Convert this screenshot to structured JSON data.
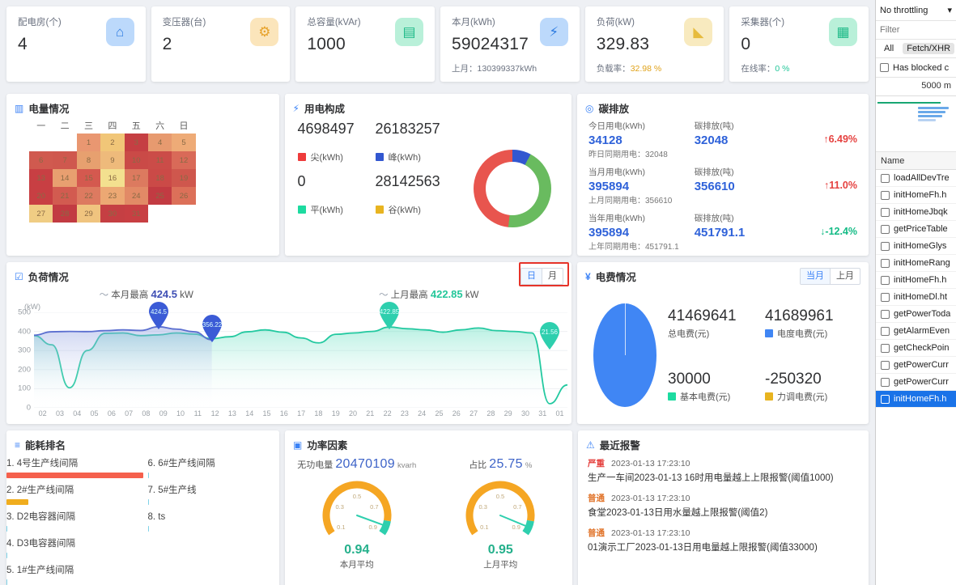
{
  "kpis": [
    {
      "label": "配电房(个)",
      "value": "4",
      "icon": "house-bolt-icon",
      "icon_class": "ic-blue"
    },
    {
      "label": "变压器(台)",
      "value": "2",
      "icon": "transformer-icon",
      "icon_class": "ic-org"
    },
    {
      "label": "总容量(kVAr)",
      "value": "1000",
      "icon": "capacity-icon",
      "icon_class": "ic-grn"
    },
    {
      "label": "本月(kWh)",
      "value": "59024317",
      "sub_label": "上月：",
      "sub_value": "130399337kWh",
      "sub_class": "b",
      "icon": "bolt-icon",
      "icon_class": "ic-blue2"
    },
    {
      "label": "负荷(kW)",
      "value": "329.83",
      "sub_label": "负载率：",
      "sub_value": "32.98 %",
      "sub_class": "warn",
      "icon": "load-icon",
      "icon_class": "ic-yel"
    },
    {
      "label": "采集器(个)",
      "value": "0",
      "sub_label": "在线率：",
      "sub_value": "0 %",
      "sub_class": "ok",
      "icon": "collector-icon",
      "icon_class": "ic-grn"
    }
  ],
  "electricity": {
    "title": "电量情况",
    "weekdays": [
      "一",
      "二",
      "三",
      "四",
      "五",
      "六",
      "日"
    ],
    "weeks": [
      [
        null,
        null,
        {
          "d": 1,
          "c": "#e99771"
        },
        {
          "d": 2,
          "c": "#f1c678"
        },
        {
          "d": 3,
          "c": "#c53f43"
        },
        {
          "d": 4,
          "c": "#e79a6f"
        },
        {
          "d": 5,
          "c": "#eeab77"
        }
      ],
      [
        {
          "d": 6,
          "c": "#d05a4f"
        },
        {
          "d": 7,
          "c": "#cf584e"
        },
        {
          "d": 8,
          "c": "#e7a06f"
        },
        {
          "d": 9,
          "c": "#eeba7b"
        },
        {
          "d": 10,
          "c": "#ca4a47"
        },
        {
          "d": 11,
          "c": "#cb4c48"
        },
        {
          "d": 12,
          "c": "#d96a58"
        }
      ],
      [
        {
          "d": 13,
          "c": "#c83f43"
        },
        {
          "d": 14,
          "c": "#e89f70"
        },
        {
          "d": 15,
          "c": "#d4594f"
        },
        {
          "d": 16,
          "c": "#f3e08f"
        },
        {
          "d": 17,
          "c": "#dc7a5f"
        },
        {
          "d": 18,
          "c": "#cb4a47"
        },
        {
          "d": 19,
          "c": "#cf574d"
        }
      ],
      [
        {
          "d": 20,
          "c": "#c83f43"
        },
        {
          "d": 21,
          "c": "#d25b50"
        },
        {
          "d": 22,
          "c": "#dd7a60"
        },
        {
          "d": 23,
          "c": "#eca873"
        },
        {
          "d": 24,
          "c": "#e28a66"
        },
        {
          "d": 25,
          "c": "#c23b42"
        },
        {
          "d": 26,
          "c": "#dc7059"
        }
      ],
      [
        {
          "d": 27,
          "c": "#f0cd84"
        },
        {
          "d": 28,
          "c": "#c23b42"
        },
        {
          "d": 29,
          "c": "#f0c47f"
        },
        {
          "d": 30,
          "c": "#c53f43"
        },
        {
          "d": 31,
          "c": "#c83f43"
        },
        null,
        null
      ]
    ]
  },
  "composition": {
    "title": "用电构成",
    "items": [
      {
        "value": "4698497",
        "legend": "尖(kWh)",
        "color": "#ee3b3b"
      },
      {
        "value": "26183257",
        "legend": "峰(kWh)",
        "color": "#3257d0"
      },
      {
        "value": "0",
        "legend": "平(kWh)",
        "color": "#1ddba0"
      },
      {
        "value": "28142563",
        "legend": "谷(kWh)",
        "color": "#e8b420"
      }
    ],
    "donut_gradient": "conic-gradient(from 0deg, #3257d0 0deg 28deg, #69bb5f 28deg 186deg, #e8554e 186deg 360deg)"
  },
  "carbon": {
    "title": "碳排放",
    "rows": [
      {
        "left_label": "今日用电(kWh)",
        "left_value": "34128",
        "note": "昨日同期用电：32048",
        "right_label": "碳排放(吨)",
        "right_value": "32048",
        "pct": "6.49%",
        "dir": "up"
      },
      {
        "left_label": "当月用电(kWh)",
        "left_value": "395894",
        "note": "上月同期用电：356610",
        "right_label": "碳排放(吨)",
        "right_value": "356610",
        "pct": "11.0%",
        "dir": "up"
      },
      {
        "left_label": "当年用电(kWh)",
        "left_value": "395894",
        "note": "上年同期用电：451791.1",
        "right_label": "碳排放(吨)",
        "right_value": "451791.1",
        "pct": "-12.4%",
        "dir": "down"
      }
    ]
  },
  "load": {
    "title": "负荷情况",
    "toggle": [
      {
        "label": "日",
        "active": true
      },
      {
        "label": "月",
        "active": false
      }
    ],
    "max_this_label": "本月最高",
    "max_this_value": "424.5",
    "max_this_unit": "kW",
    "max_last_label": "上月最高",
    "max_last_value": "422.85",
    "max_last_unit": "kW",
    "marker_a": "424.5",
    "marker_b": "356.22",
    "marker_c": "422.85",
    "marker_d": "21.56",
    "chart_data": {
      "type": "line",
      "title": "负荷情况",
      "ylabel": "(kW)",
      "ylim": [
        0,
        500
      ],
      "yticks": [
        0,
        100,
        200,
        300,
        400,
        500
      ],
      "x": [
        "02",
        "03",
        "04",
        "05",
        "06",
        "07",
        "08",
        "09",
        "10",
        "11",
        "12",
        "13",
        "14",
        "15",
        "16",
        "17",
        "18",
        "19",
        "20",
        "21",
        "22",
        "23",
        "24",
        "25",
        "26",
        "27",
        "28",
        "29",
        "30",
        "31",
        "01"
      ],
      "series": [
        {
          "name": "本月",
          "color": "#5b6fd0",
          "values": [
            380,
            398,
            400,
            399,
            404,
            408,
            405,
            424.5,
            412,
            398,
            356.22,
            null,
            null,
            null,
            null,
            null,
            null,
            null,
            null,
            null,
            null,
            null,
            null,
            null,
            null,
            null,
            null,
            null,
            null,
            null,
            null
          ]
        },
        {
          "name": "上月",
          "color": "#23c9a0",
          "values": [
            378,
            330,
            105,
            300,
            390,
            392,
            378,
            382,
            392,
            386,
            362,
            372,
            398,
            408,
            396,
            366,
            340,
            385,
            392,
            400,
            422.85,
            414,
            408,
            396,
            408,
            418,
            404,
            400,
            392,
            21.56,
            120
          ]
        }
      ]
    }
  },
  "fee": {
    "title": "电费情况",
    "toggle": [
      {
        "label": "当月",
        "active": true
      },
      {
        "label": "上月",
        "active": false
      }
    ],
    "items": [
      {
        "value": "41469641",
        "legend": "总电费(元)",
        "color": null
      },
      {
        "value": "41689961",
        "legend": "电度电费(元)",
        "color": "#4086f4"
      },
      {
        "value": "30000",
        "legend": "基本电费(元)",
        "color": "#1ddba0"
      },
      {
        "value": "-250320",
        "legend": "力调电费(元)",
        "color": "#e8b420"
      }
    ]
  },
  "rank": {
    "title": "能耗排名",
    "left": [
      {
        "label": "1. 4号生产线间隔",
        "bar_pct": 100,
        "color": "#f5604d"
      },
      {
        "label": "2. 2#生产线间隔",
        "bar_pct": 16,
        "color": "#f0ad1e"
      },
      {
        "label": "3. D2电容器间隔",
        "bar_pct": 0,
        "color": "#7fd3e8"
      },
      {
        "label": "4. D3电容器间隔",
        "bar_pct": 0,
        "color": "#7fd3e8"
      },
      {
        "label": "5. 1#生产线间隔",
        "bar_pct": 0,
        "color": "#7fd3e8"
      }
    ],
    "right": [
      {
        "label": "6. 6#生产线间隔",
        "bar_pct": 1,
        "color": "#7fd3e8"
      },
      {
        "label": "7. 5#生产线",
        "bar_pct": 1,
        "color": "#7fd3e8"
      },
      {
        "label": "8. ts",
        "bar_pct": 1,
        "color": "#7fd3e8"
      }
    ]
  },
  "powerfactor": {
    "title": "功率因素",
    "reactive_label": "无功电量",
    "reactive_value": "20470109",
    "reactive_unit": "kvarh",
    "ratio_label": "占比",
    "ratio_value": "25.75",
    "ratio_unit": "%",
    "ticks": [
      "0.1",
      "0.3",
      "0.5",
      "0.7",
      "0.9"
    ],
    "gauges": [
      {
        "value": "0.94",
        "label": "本月平均"
      },
      {
        "value": "0.95",
        "label": "上月平均"
      }
    ]
  },
  "alarms": {
    "title": "最近报警",
    "items": [
      {
        "level": "严重",
        "level_class": "lvl-high",
        "time": "2023-01-13 17:23:10",
        "text": "生产一车间2023-01-13 16时用电量越上上限报警(阈值1000)"
      },
      {
        "level": "普通",
        "level_class": "lvl-norm",
        "time": "2023-01-13 17:23:10",
        "text": "食堂2023-01-13日用水量越上限报警(阈值2)"
      },
      {
        "level": "普通",
        "level_class": "lvl-norm",
        "time": "2023-01-13 17:23:10",
        "text": "01演示工厂2023-01-13日用电量越上限报警(阈值33000)"
      }
    ]
  },
  "devtools": {
    "throttle": "No throttling",
    "chevron": "▾",
    "filter_placeholder": "Filter",
    "type_all": "All",
    "type_fetch": "Fetch/XHR",
    "has_blocked": "Has blocked c",
    "overview_time": "5000 m",
    "name_header": "Name",
    "requests": [
      {
        "name": "loadAllDevTre",
        "selected": false
      },
      {
        "name": "initHomeFh.h",
        "selected": false
      },
      {
        "name": "initHomeJbqk",
        "selected": false
      },
      {
        "name": "getPriceTable",
        "selected": false
      },
      {
        "name": "initHomeGlys",
        "selected": false
      },
      {
        "name": "initHomeRang",
        "selected": false
      },
      {
        "name": "initHomeFh.h",
        "selected": false
      },
      {
        "name": "initHomeDl.ht",
        "selected": false
      },
      {
        "name": "getPowerToda",
        "selected": false
      },
      {
        "name": "getAlarmEven",
        "selected": false
      },
      {
        "name": "getCheckPoin",
        "selected": false
      },
      {
        "name": "getPowerCurr",
        "selected": false
      },
      {
        "name": "getPowerCurr",
        "selected": false
      },
      {
        "name": "initHomeFh.h",
        "selected": true
      }
    ]
  }
}
